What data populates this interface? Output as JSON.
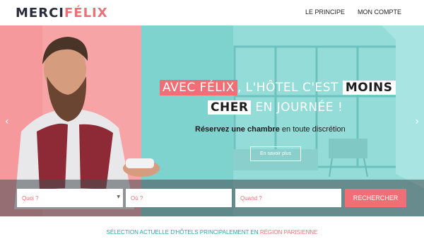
{
  "header": {
    "logo_part1": "MERCI",
    "logo_part2": "FÉLIX",
    "nav": [
      {
        "label": "LE PRINCIPE"
      },
      {
        "label": "MON COMPTE"
      }
    ]
  },
  "hero": {
    "headline": {
      "highlight": "AVEC FÉLIX",
      "middle": ", L'HÔTEL C'EST",
      "bold1": "MOINS",
      "bold2": "CHER",
      "end": "EN JOURNÉE !"
    },
    "subtitle": {
      "part1": "Réservez une chambre",
      "part2": " en toute discrétion"
    },
    "more_button": "En savoir plus",
    "arrow_left": "‹",
    "arrow_right": "›"
  },
  "search": {
    "what_placeholder": "Quoi ?",
    "where_placeholder": "Où ?",
    "when_placeholder": "Quand ?",
    "button_label": "RECHERCHER"
  },
  "selection": {
    "text": "SÉLECTION ACTUELLE D'HÔTELS PRINCIPALEMENT EN ",
    "region": "RÉGION PARISIENNE"
  },
  "colors": {
    "brand_pink": "#f06f76",
    "teal": "#7ed3cf",
    "dark": "#2b2b3b"
  }
}
